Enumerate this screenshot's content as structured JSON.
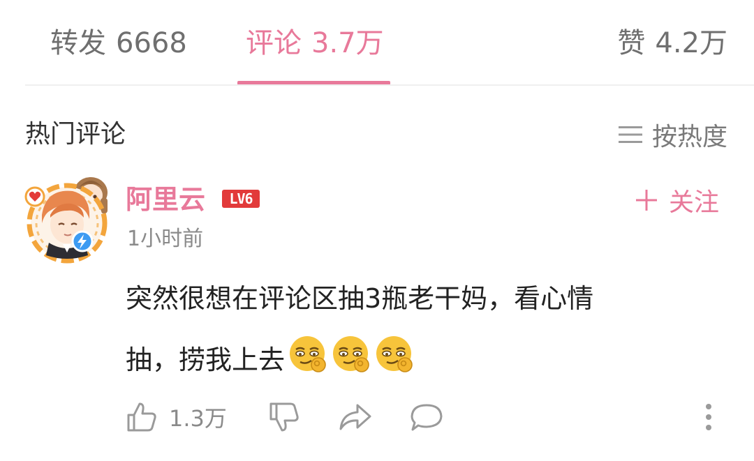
{
  "tabs": {
    "reposts": {
      "label": "转发",
      "count": "6668"
    },
    "comments": {
      "label": "评论",
      "count": "3.7万",
      "active": true
    },
    "likes": {
      "label": "赞",
      "count": "4.2万"
    }
  },
  "section": {
    "title": "热门评论",
    "sort_label": "按热度",
    "sort_icon": "menu-lines-icon"
  },
  "comment": {
    "avatar": "anime-boy-avatar",
    "username": "阿里云",
    "level": "LV6",
    "follow_label": "关注",
    "timestamp": "1小时前",
    "text_line1": "突然很想在评论区抽3瓶老干妈，看心情",
    "text_line2": "抽，捞我上去",
    "emojis": [
      "smirk-ok-emoji",
      "smirk-ok-emoji",
      "smirk-ok-emoji"
    ],
    "like_count": "1.3万"
  },
  "colors": {
    "accent": "#e8799a",
    "level_badge": "#e23a3a",
    "muted_text": "#8a8a8a",
    "icon_gray": "#9a9a9a"
  }
}
